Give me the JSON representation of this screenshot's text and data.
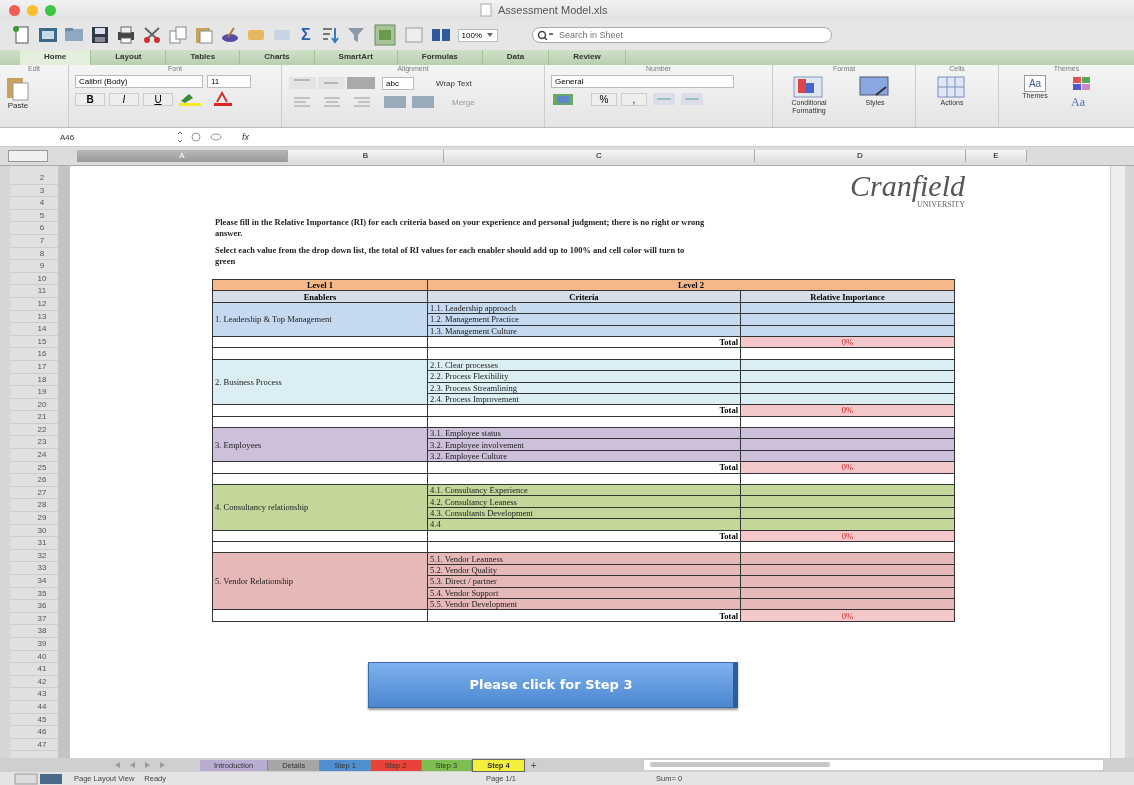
{
  "window": {
    "title": "Assessment Model.xls"
  },
  "toolbar": {
    "sum": "Σ",
    "zoom": "100%",
    "search": {
      "placeholder": "Search in Sheet"
    }
  },
  "ribbon_tabs": [
    {
      "label": "Home",
      "selected": true
    },
    {
      "label": "Layout",
      "selected": false
    },
    {
      "label": "Tables",
      "selected": false
    },
    {
      "label": "Charts",
      "selected": false
    },
    {
      "label": "SmartArt",
      "selected": false
    },
    {
      "label": "Formulas",
      "selected": false
    },
    {
      "label": "Data",
      "selected": false
    },
    {
      "label": "Review",
      "selected": false
    }
  ],
  "ribbon": {
    "edit": {
      "label": "Edit",
      "paste": "Paste"
    },
    "font": {
      "label": "Font",
      "family": "Calibri (Body)",
      "size": "11",
      "styles": [
        "B",
        "I",
        "U"
      ]
    },
    "alignment": {
      "label": "Alignment",
      "orientation": "abc",
      "wrap": "Wrap Text",
      "merge": "Merge"
    },
    "number": {
      "label": "Number",
      "format": "General",
      "buttons": [
        "%",
        ","
      ]
    },
    "format": {
      "label": "Format",
      "conditional": "Conditional Formatting",
      "styles": "Styles"
    },
    "cells": {
      "label": "Cells",
      "actions": "Actions"
    },
    "themes": {
      "label": "Themes",
      "themes": "Themes",
      "fonts": "Aa",
      "preview": "Aa"
    }
  },
  "formula_bar": {
    "name_box": "A46",
    "fx": "fx"
  },
  "columns": [
    "A",
    "B",
    "C",
    "D",
    "E"
  ],
  "rows": [
    "2",
    "3",
    "4",
    "5",
    "6",
    "7",
    "8",
    "9",
    "10",
    "11",
    "12",
    "13",
    "14",
    "15",
    "16",
    "17",
    "18",
    "19",
    "20",
    "21",
    "22",
    "23",
    "24",
    "25",
    "26",
    "27",
    "28",
    "29",
    "30",
    "31",
    "32",
    "33",
    "34",
    "35",
    "36",
    "37",
    "38",
    "39",
    "40",
    "41",
    "42",
    "43",
    "44",
    "45",
    "46",
    "47"
  ],
  "logo": {
    "name": "Cranfield",
    "subtitle": "UNIVERSITY"
  },
  "instructions": [
    "Please fill in the Relative Importance (RI) for each criteria based on your experience and personal judgment; there is no right or wrong answer.",
    "Select each value from the drop down list, the total of RI values for each enabler should add up to 100% and cell color will turn to green"
  ],
  "table": {
    "level_headers": [
      "Level 1",
      "Level 2"
    ],
    "columns": [
      "Enablers",
      "Criteria",
      "Relative Importance"
    ],
    "groups": [
      {
        "enabler": "1. Leadership & Top Management",
        "color": "#c5d9f1",
        "criteria": [
          "1.1. Leadership approach",
          "1.2. Management Practice",
          "1.3. Management Culture"
        ],
        "total_label": "Total",
        "total": "0%"
      },
      {
        "enabler": "2. Business Process",
        "color": "#daeef3",
        "criteria": [
          "2.1. Clear processes",
          "2.2. Process Flexibility",
          "2.3. Process Streamlining",
          "2.4. Process Improvement"
        ],
        "total_label": "Total",
        "total": "0%"
      },
      {
        "enabler": "3. Employees",
        "color": "#ccc0da",
        "criteria": [
          "3.1. Employee status",
          "3.2. Employee involvement",
          "3.2.  Employee Culture"
        ],
        "total_label": "Total",
        "total": "0%"
      },
      {
        "enabler": "4. Consultancy relationship",
        "color": "#c4d79b",
        "criteria": [
          "4.1. Consultancy Experience",
          "4.2. Consultancy Leaness",
          "4.3. Consultants Development",
          "4.4"
        ],
        "total_label": "Total",
        "total": "0%"
      },
      {
        "enabler": "5. Vendor Relationship",
        "color": "#e6b8b7",
        "criteria": [
          "5.1. Vendor Leanness",
          "5.2. Vendor Quality",
          "5.3. Direct / partner",
          "5.4. Vendor Support",
          "5.5. Vendor Development"
        ],
        "total_label": "Total",
        "total": "0%"
      }
    ]
  },
  "step_button": "Please click for Step 3",
  "sheet_tabs": [
    {
      "label": "Introduction",
      "color": "#b9acd2",
      "selected": false
    },
    {
      "label": "Details",
      "color": "#a6a6a6",
      "selected": false
    },
    {
      "label": "Step 1",
      "color": "#4f8fd0",
      "selected": false
    },
    {
      "label": "Step 2",
      "color": "#e8433a",
      "selected": false
    },
    {
      "label": "Step 3",
      "color": "#7cbf4f",
      "selected": false
    },
    {
      "label": "Step 4",
      "color": "#f2f03c",
      "selected": true
    }
  ],
  "add_sheet": "+",
  "status_bar": {
    "view": "Page Layout View",
    "state": "Ready",
    "page": "Page 1/1",
    "sum": "Sum= 0"
  }
}
